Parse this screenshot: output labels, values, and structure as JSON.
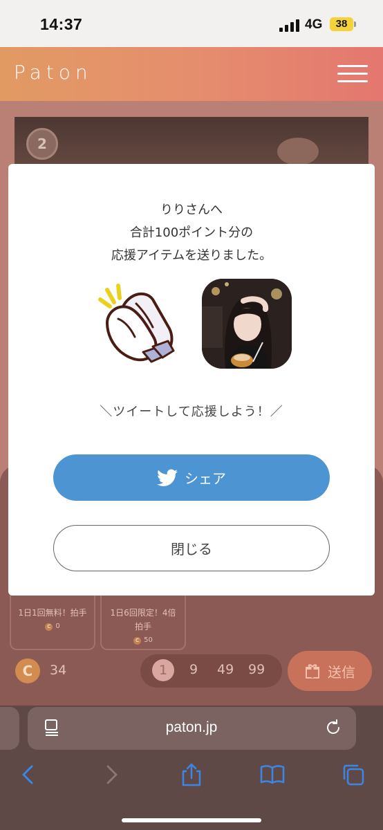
{
  "status_bar": {
    "time": "14:37",
    "network": "4G",
    "battery": "38"
  },
  "app": {
    "brand": "Paton"
  },
  "background_page": {
    "rank_badge": "2",
    "items": [
      {
        "label": "1日1回無料！拍手",
        "price": "0"
      },
      {
        "label": "1日6回限定！4倍拍手",
        "price": "50"
      }
    ],
    "coin_symbol": "C",
    "mini_coin_symbol": "C",
    "coin_balance": "34",
    "amount_options": [
      "1",
      "9",
      "49",
      "99"
    ],
    "selected_amount": "1",
    "send_label": "送信"
  },
  "modal": {
    "message_line1": "りりさんへ",
    "message_line2": "合計100ポイント分の",
    "message_line3": "応援アイテムを送りました。",
    "tweet_prompt": "＼ツイートして応援しよう！／",
    "share_label": "シェア",
    "close_label": "閉じる"
  },
  "browser": {
    "url": "paton.jp"
  },
  "colors": {
    "accent": "#4d95d2",
    "header_start": "#e29a63",
    "header_end": "#e4776f",
    "toolbar_blue": "#3b86e6"
  }
}
